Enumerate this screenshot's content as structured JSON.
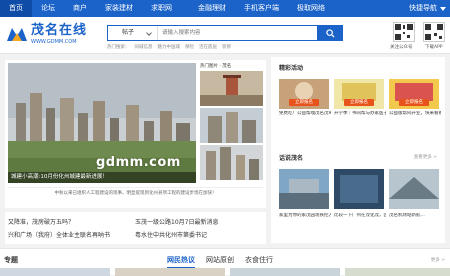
{
  "nav": {
    "items": [
      "首页",
      "论坛",
      "商户",
      "家装建材",
      "求职网",
      "金融理财",
      "手机客户端",
      "极取网络"
    ],
    "right_label": "快捷导航"
  },
  "header": {
    "logo_text": "茂名在线",
    "logo_url": "WWW.GDMM.COM",
    "search_category": "帖子",
    "search_placeholder": "请输入搜索内容",
    "hot_words": [
      "热门搜索：",
      "同城信息",
      "魅力中国城",
      "保险",
      "活在底层",
      "装修"
    ],
    "qr1_label": "关注公众号",
    "qr2_label": "下载APP"
  },
  "feature": {
    "caption": "城建小高潮:10月份化州城建最新进展！",
    "watermark": "gdmm.com",
    "thumb_title": "热门图片 · 茂名",
    "ticker": "中秋以来已组织人工程建设的现事，明显提现到化州县项工程的建设步伐在加快！"
  },
  "news": {
    "items": [
      "又降准，茂房破万五吗？",
      "玉茂一级公路10月7日最新消息",
      "兴和广场（我府）全体业主联名再呐书",
      "粤水住中共化州市第委书记"
    ]
  },
  "right": {
    "section1_title": "精彩活动",
    "tiles": [
      {
        "badge": "立即报名",
        "text": "免费吃！公益帮嘎茂名茂9月9日..."
      },
      {
        "badge": "立即报名",
        "text": "开学季｜书同帮与办家医子装修了..."
      },
      {
        "badge": "立即报名",
        "text": "公益版帮同开业，快来看看你家..."
      }
    ],
    "section2_title": "话说茂名",
    "section2_more": "查看更多 >",
    "tiles2_text": [
      "家里为你的家茂园现铁挖方，在化下户..",
      "比较一下广州在茂化茂，区间一下广州..",
      "茂名机场站新航..."
    ]
  },
  "bottom": {
    "label": "专题",
    "tabs": [
      "网民热议",
      "网站原创",
      "衣食住行"
    ],
    "more": "更多 >"
  },
  "colors": {
    "nav_blue": "#1b63c9",
    "badge_orange": "#e8521b"
  }
}
